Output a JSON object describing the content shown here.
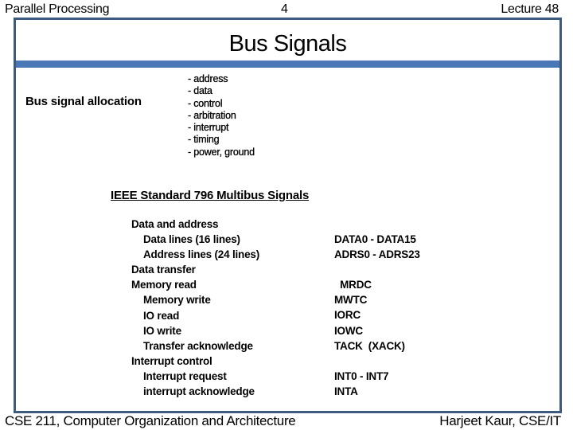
{
  "header": {
    "left": "Parallel Processing",
    "page_number": "4",
    "right": "Lecture 48"
  },
  "slide": {
    "title": "Bus Signals",
    "colors": {
      "frame_border": "#3d5b80",
      "title_bar": "#4a78b6"
    },
    "allocation": {
      "label": "Bus signal allocation",
      "items": [
        "- address",
        "- data",
        "- control",
        "- arbitration",
        "- interrupt",
        "- timing",
        "- power, ground"
      ]
    },
    "ieee": {
      "heading": "IEEE Standard 796 Multibus Signals",
      "signals": [
        {
          "label": "Data and address",
          "indent": false,
          "code": ""
        },
        {
          "label": "Data lines (16 lines)",
          "indent": true,
          "code": "DATA0 - DATA15"
        },
        {
          "label": "Address lines (24 lines)",
          "indent": true,
          "code": "ADRS0 - ADRS23"
        },
        {
          "label": "Data transfer",
          "indent": false,
          "code": ""
        },
        {
          "label": "Memory read",
          "indent": false,
          "code": "  MRDC"
        },
        {
          "label": "Memory write",
          "indent": true,
          "code": "MWTC"
        },
        {
          "label": "IO read",
          "indent": true,
          "code": "IORC"
        },
        {
          "label": "IO write",
          "indent": true,
          "code": "IOWC"
        },
        {
          "label": "Transfer acknowledge",
          "indent": true,
          "code": "TACK  (XACK)"
        },
        {
          "label": "Interrupt control",
          "indent": false,
          "code": ""
        },
        {
          "label": "Interrupt request",
          "indent": true,
          "code": "INT0 - INT7"
        },
        {
          "label": "interrupt acknowledge",
          "indent": true,
          "code": "INTA"
        }
      ]
    }
  },
  "footer": {
    "left": "CSE 211, Computer Organization and Architecture",
    "right": "Harjeet Kaur, CSE/IT"
  }
}
